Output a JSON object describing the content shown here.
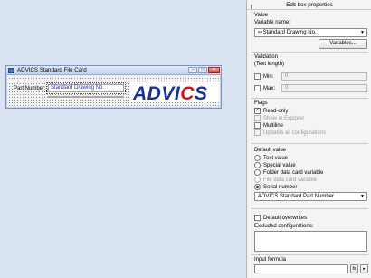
{
  "card": {
    "title": "ADVICS Standard File Card",
    "controls": {
      "minimize": "–",
      "maximize": "□",
      "close": "✕"
    },
    "part_label": "Part Number:",
    "part_value": "Standard Drawing No.",
    "logo_text": "ADVICS",
    "logo_color": "#1c2f8e",
    "logo_accent": "#d40f1b"
  },
  "panel": {
    "header": "Edit box properties",
    "value_section": "Value",
    "variable_name_label": "Variable name:",
    "variable_name_value": "Standard Drawing No.",
    "variable_icon": "variable-icon",
    "variables_button": "Variables...",
    "validation_section": "Validation",
    "text_length_label": "(Text length)",
    "min_label": "Min:",
    "min_value": "0",
    "max_label": "Max:",
    "max_value": "0",
    "flags_section": "Flags",
    "flags": [
      {
        "label": "Read-only",
        "checked": true,
        "disabled": false
      },
      {
        "label": "Show in Explorer",
        "checked": false,
        "disabled": true
      },
      {
        "label": "Multiline",
        "checked": false,
        "disabled": false
      },
      {
        "label": "Updates all configurations",
        "checked": false,
        "disabled": true
      }
    ],
    "default_section": "Default value",
    "defaults": [
      {
        "label": "Text value",
        "selected": false,
        "disabled": false
      },
      {
        "label": "Special value",
        "selected": false,
        "disabled": false
      },
      {
        "label": "Folder data card variable",
        "selected": false,
        "disabled": false
      },
      {
        "label": "File data card variable",
        "selected": false,
        "disabled": true
      },
      {
        "label": "Serial number",
        "selected": true,
        "disabled": false
      }
    ],
    "serial_combo_value": "ADVICS Standard Part Number",
    "default_overwrites_label": "Default overwrites",
    "excluded_label": "Excluded configurations:",
    "input_formula_label": "Input formula",
    "formula_btn1": "fx",
    "formula_btn2": "▸"
  }
}
